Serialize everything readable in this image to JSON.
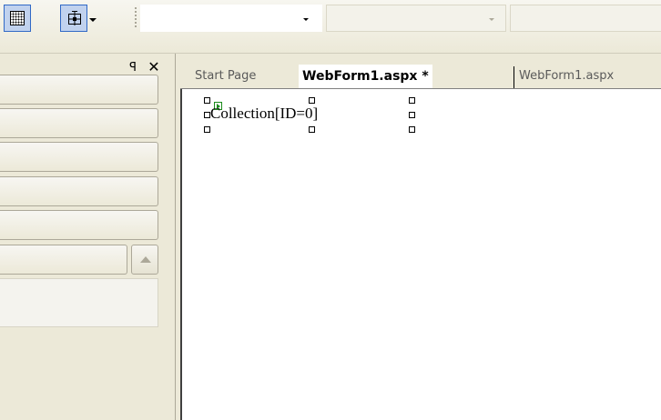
{
  "toolbar": {
    "buttons": [
      {
        "name": "show-grid",
        "icon": "grid-icon",
        "pressed": true
      },
      {
        "name": "snap-to-grid",
        "icon": "snap-to-grid-icon",
        "pressed": true,
        "has_dropdown": true
      }
    ],
    "combos": [
      {
        "value": "",
        "enabled": true
      },
      {
        "value": "",
        "enabled": false
      },
      {
        "value": "",
        "enabled": false
      }
    ],
    "accent_color": "#3169c6",
    "pressed_color": "#c1d2ee"
  },
  "left_pane": {
    "pin_icon": "pin-icon",
    "pin_glyph": "ꟼ",
    "close_glyph": "✕",
    "rows": 6,
    "scroll_button_icon": "scroll-up-icon"
  },
  "tabs": [
    {
      "label": "Start Page",
      "active": false
    },
    {
      "label": "WebForm1.aspx *",
      "active": true
    },
    {
      "label": "WebForm1.aspx",
      "active": false
    }
  ],
  "design_surface": {
    "control_text": "Collection[ID=0]",
    "smart_tag_icon": "smart-tag-icon",
    "handle_color": "#000000",
    "smart_tag_color": "#1b8a1b"
  }
}
